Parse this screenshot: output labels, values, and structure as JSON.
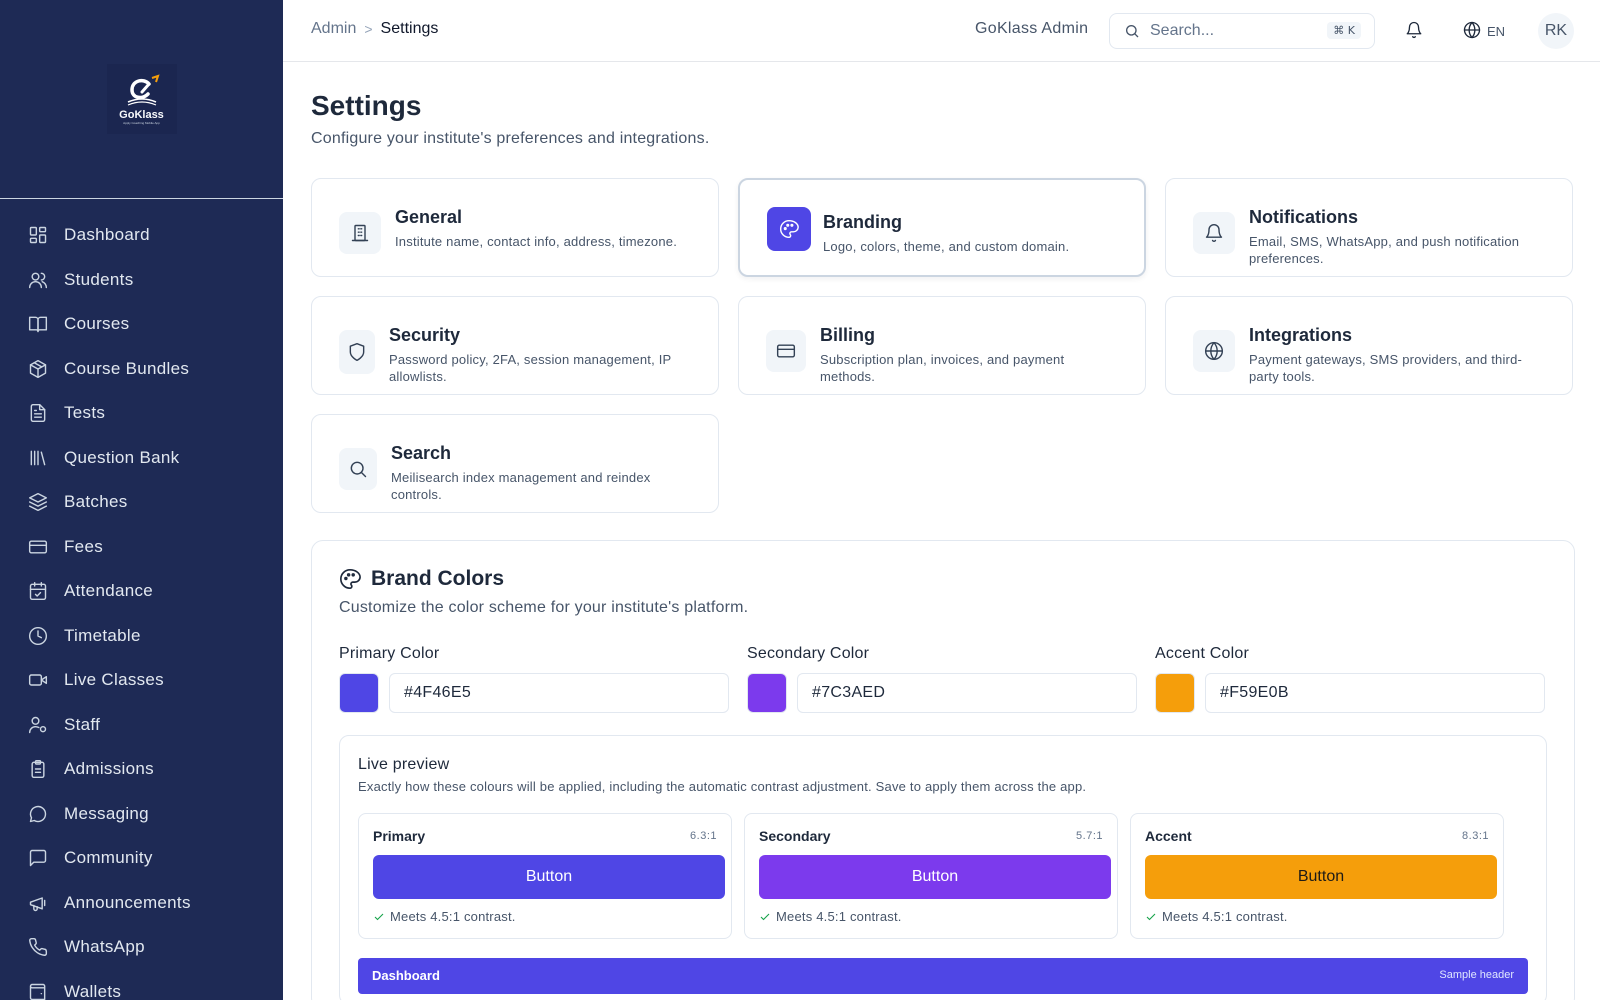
{
  "brand": {
    "name": "GoKlass",
    "tagline": "Apply Coaching Mobile App"
  },
  "sidebar": {
    "items": [
      {
        "label": "Dashboard",
        "icon": "dashboard-icon"
      },
      {
        "label": "Students",
        "icon": "users-icon"
      },
      {
        "label": "Courses",
        "icon": "book-open-icon"
      },
      {
        "label": "Course Bundles",
        "icon": "package-icon"
      },
      {
        "label": "Tests",
        "icon": "file-text-icon"
      },
      {
        "label": "Question Bank",
        "icon": "library-icon"
      },
      {
        "label": "Batches",
        "icon": "layers-icon"
      },
      {
        "label": "Fees",
        "icon": "credit-card-icon"
      },
      {
        "label": "Attendance",
        "icon": "calendar-check-icon"
      },
      {
        "label": "Timetable",
        "icon": "clock-icon"
      },
      {
        "label": "Live Classes",
        "icon": "video-icon"
      },
      {
        "label": "Staff",
        "icon": "user-cog-icon"
      },
      {
        "label": "Admissions",
        "icon": "clipboard-icon"
      },
      {
        "label": "Messaging",
        "icon": "message-circle-icon"
      },
      {
        "label": "Community",
        "icon": "message-square-icon"
      },
      {
        "label": "Announcements",
        "icon": "megaphone-icon"
      },
      {
        "label": "WhatsApp",
        "icon": "phone-icon"
      },
      {
        "label": "Wallets",
        "icon": "wallet-icon"
      }
    ]
  },
  "topbar": {
    "breadcrumb": {
      "root": "Admin",
      "separator": ">",
      "current": "Settings"
    },
    "institute": "GoKlass Admin",
    "search_placeholder": "Search...",
    "shortcut": "⌘ K",
    "language": "EN",
    "avatar_initials": "RK"
  },
  "page": {
    "title": "Settings",
    "subtitle": "Configure your institute's preferences and integrations."
  },
  "cards": [
    {
      "title": "General",
      "desc": "Institute name, contact info, address, timezone.",
      "icon": "building-icon"
    },
    {
      "title": "Branding",
      "desc": "Logo, colors, theme, and custom domain.",
      "icon": "palette-icon"
    },
    {
      "title": "Notifications",
      "desc": "Email, SMS, WhatsApp, and push notification preferences.",
      "icon": "bell-icon"
    },
    {
      "title": "Security",
      "desc": "Password policy, 2FA, session management, IP allowlists.",
      "icon": "shield-icon"
    },
    {
      "title": "Billing",
      "desc": "Subscription plan, invoices, and payment methods.",
      "icon": "credit-card-icon"
    },
    {
      "title": "Integrations",
      "desc": "Payment gateways, SMS providers, and third-party tools.",
      "icon": "globe-icon"
    },
    {
      "title": "Search",
      "desc": "Meilisearch index management and reindex controls.",
      "icon": "search-icon"
    }
  ],
  "brand_colors": {
    "title": "Brand Colors",
    "subtitle": "Customize the color scheme for your institute's platform.",
    "fields": [
      {
        "label": "Primary Color",
        "value": "#4F46E5",
        "color": "#4F46E5"
      },
      {
        "label": "Secondary Color",
        "value": "#7C3AED",
        "color": "#7C3AED"
      },
      {
        "label": "Accent Color",
        "value": "#F59E0B",
        "color": "#F59E0B"
      }
    ],
    "preview": {
      "title": "Live preview",
      "subtitle": "Exactly how these colours will be applied, including the automatic contrast adjustment. Save to apply them across the app.",
      "cards": [
        {
          "name": "Primary",
          "ratio": "6.3:1",
          "button": "Button",
          "bg": "#4F46E5",
          "fg": "#ffffff",
          "ok": "Meets 4.5:1 contrast."
        },
        {
          "name": "Secondary",
          "ratio": "5.7:1",
          "button": "Button",
          "bg": "#7C3AED",
          "fg": "#ffffff",
          "ok": "Meets 4.5:1 contrast."
        },
        {
          "name": "Accent",
          "ratio": "8.3:1",
          "button": "Button",
          "bg": "#F59E0B",
          "fg": "#1e1b16",
          "ok": "Meets 4.5:1 contrast."
        }
      ],
      "sample_header": {
        "title": "Dashboard",
        "tag": "Sample header"
      }
    }
  }
}
